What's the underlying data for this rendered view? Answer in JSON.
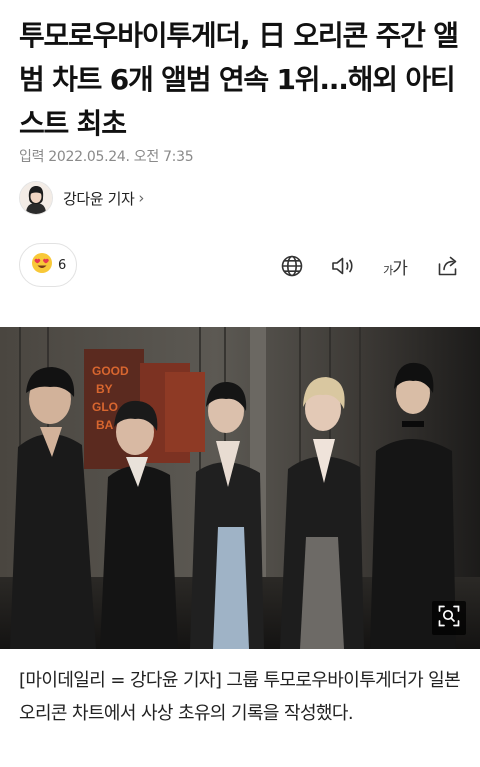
{
  "article": {
    "headline": "투모로우바이투게더, 日 오리콘 주간 앨범 차트 6개 앨범 연속 1위...해외 아티스트 최초",
    "published_label": "입력 2022.05.24. 오전 7:35",
    "reporter": {
      "name": "강다윤 기자",
      "chevron": "›"
    },
    "reactions": {
      "emoji": "heart-eyes",
      "count": "6"
    },
    "toolbar": {
      "font_size_small": "가",
      "font_size_large": "가"
    },
    "photo": {
      "poster_texts": [
        "GOOD",
        "BY",
        "GLO",
        "BA"
      ]
    },
    "body": "[마이데일리 = 강다윤 기자] 그룹 투모로우바이투게더가 일본 오리콘 차트에서 사상 초유의 기록을 작성했다."
  },
  "icons": {
    "reporter_chevron": "chevron-right-icon",
    "reaction": "heart-eyes-emoji-icon",
    "globe": "globe-icon",
    "speaker": "speaker-icon",
    "font_size": "font-size-icon",
    "share": "share-icon",
    "zoom": "zoom-search-icon"
  },
  "colors": {
    "text_primary": "#111111",
    "text_meta": "#8a8a8a",
    "pill_border": "#e2e2e2",
    "emoji_face": "#f8c838",
    "emoji_heart": "#e8384f"
  }
}
